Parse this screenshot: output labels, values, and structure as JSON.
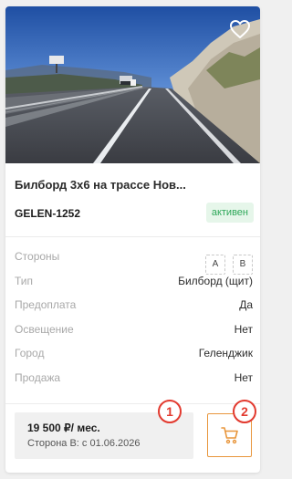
{
  "card": {
    "title": "Билборд 3х6 на трассе Нов...",
    "code": "GELEN-1252",
    "status": "активен",
    "properties": [
      {
        "label": "Стороны",
        "value": ""
      },
      {
        "label": "Тип",
        "value": "Билборд (щит)"
      },
      {
        "label": "Предоплата",
        "value": "Да"
      },
      {
        "label": "Освещение",
        "value": "Нет"
      },
      {
        "label": "Город",
        "value": "Геленджик"
      },
      {
        "label": "Продажа",
        "value": "Нет"
      }
    ],
    "sides": [
      "A",
      "B"
    ],
    "price": "19 500 ₽/ мес.",
    "price_note": "Сторона B: с 01.06.2026"
  },
  "markers": [
    "1",
    "2"
  ],
  "icons": {
    "favorite": "heart-outline-icon",
    "cart": "cart-icon"
  },
  "colors": {
    "accent": "#e8963c",
    "status_bg": "#e6f6ea",
    "status_text": "#2fa85a",
    "marker": "#e23a2f"
  }
}
